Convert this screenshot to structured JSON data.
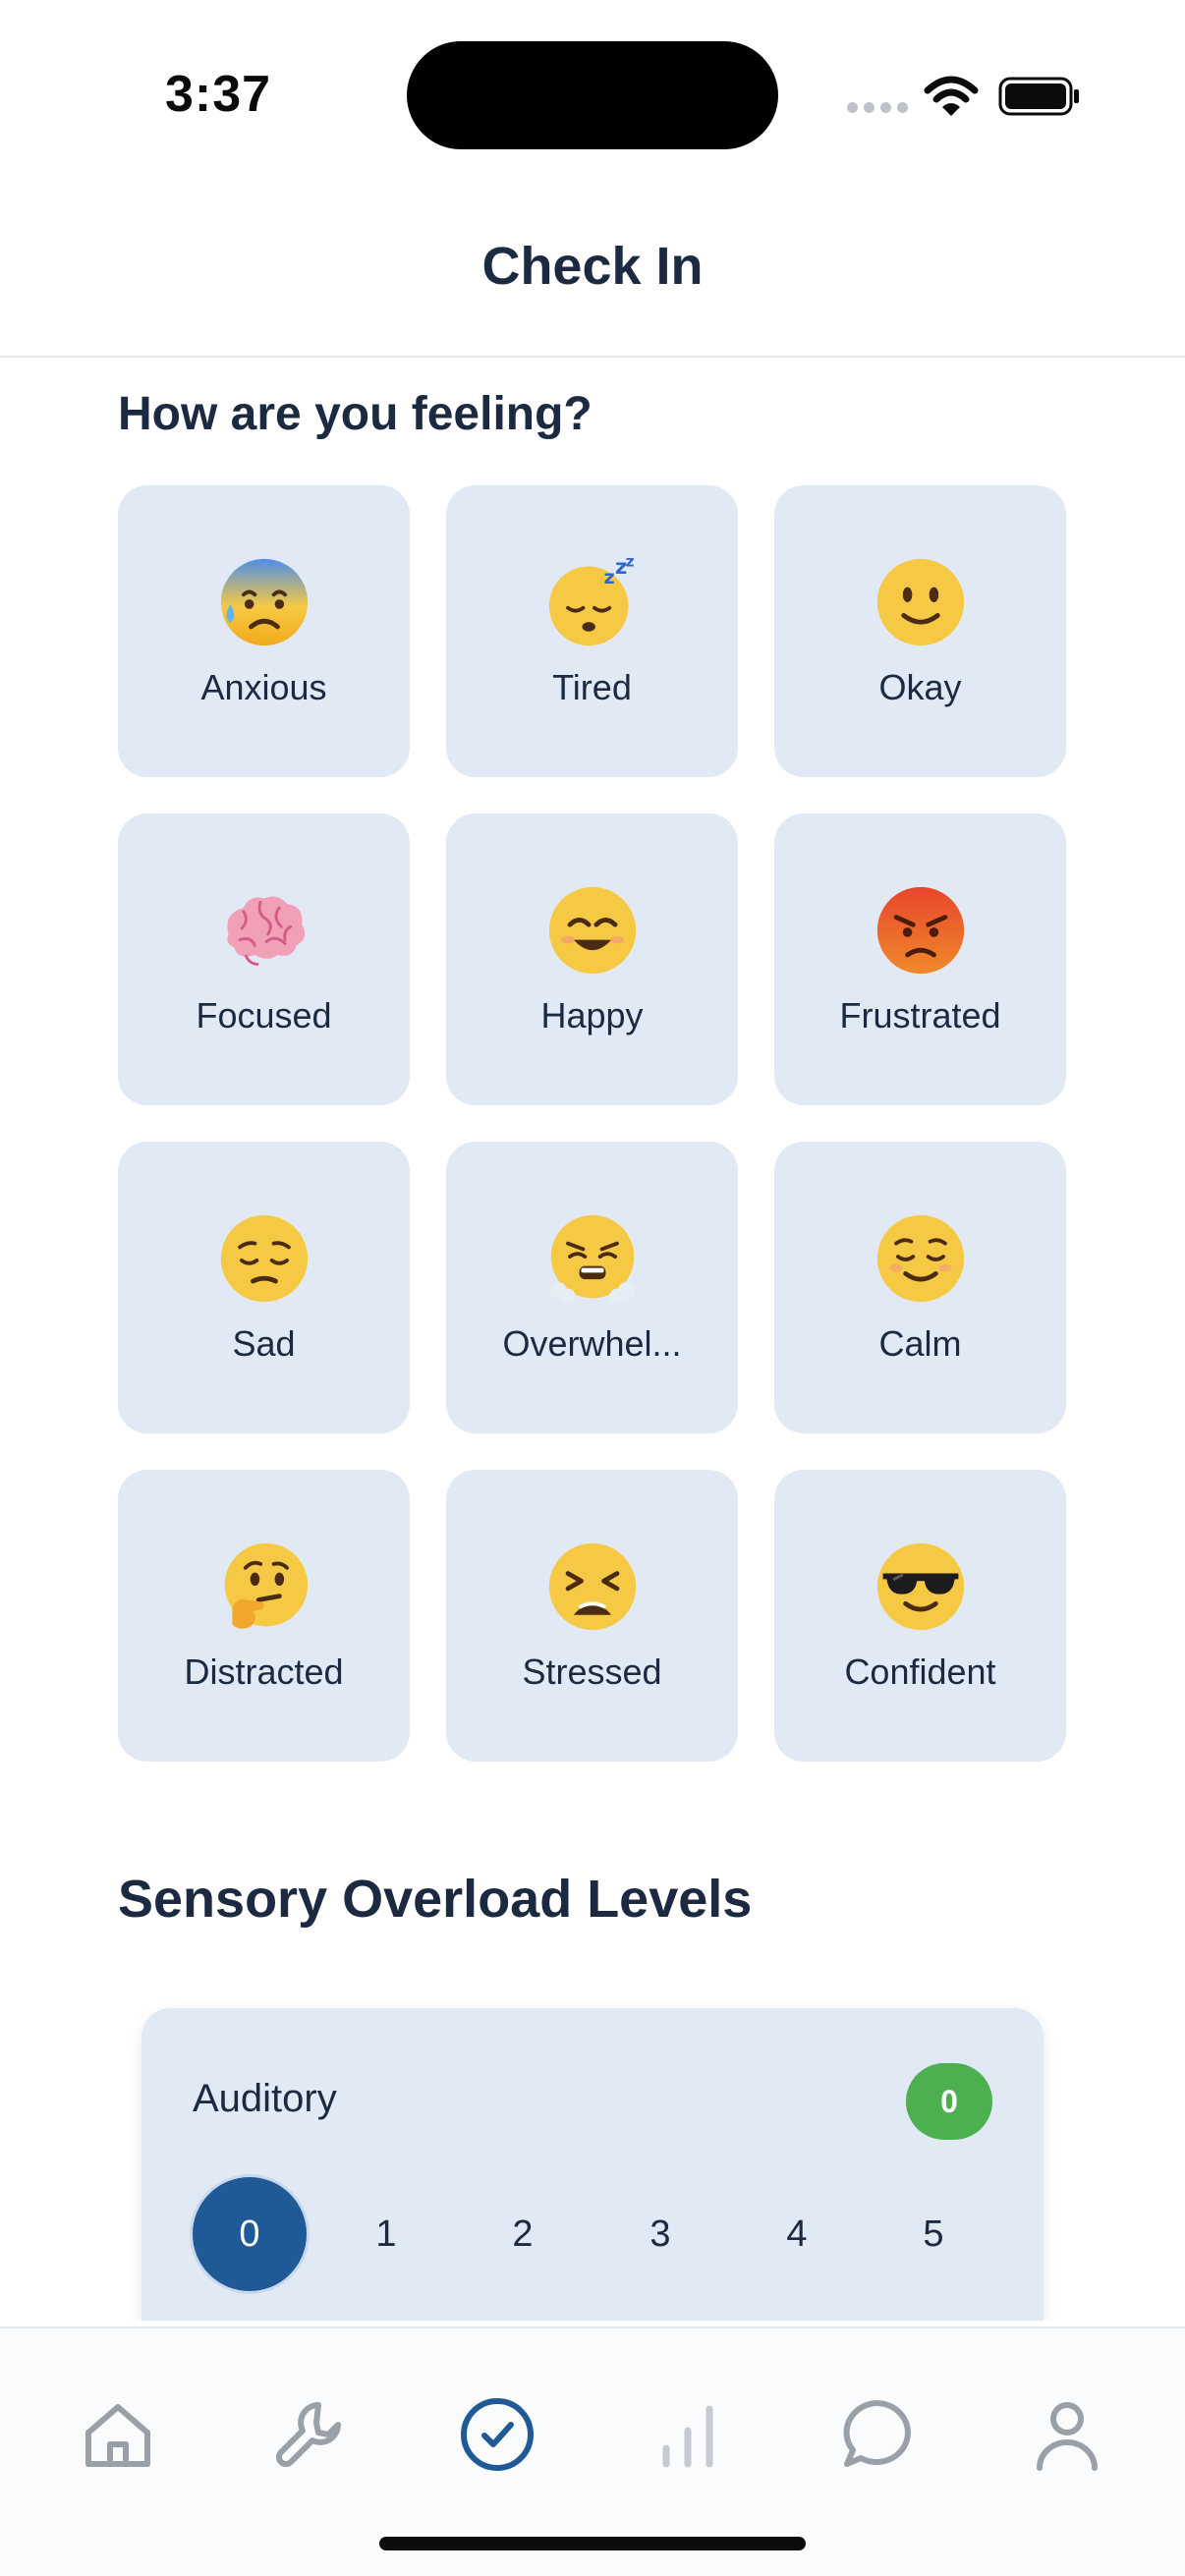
{
  "status_bar": {
    "time": "3:37"
  },
  "header": {
    "title": "Check In"
  },
  "mood_section": {
    "title": "How are you feeling?",
    "moods": [
      {
        "label": "Anxious",
        "icon": "anxious-sweat-face-icon"
      },
      {
        "label": "Tired",
        "icon": "sleeping-face-icon"
      },
      {
        "label": "Okay",
        "icon": "slightly-smiling-face-icon"
      },
      {
        "label": "Focused",
        "icon": "brain-icon"
      },
      {
        "label": "Happy",
        "icon": "smiling-face-icon"
      },
      {
        "label": "Frustrated",
        "icon": "angry-face-icon"
      },
      {
        "label": "Sad",
        "icon": "pensive-face-icon"
      },
      {
        "label": "Overwhel...",
        "icon": "steam-nose-face-icon"
      },
      {
        "label": "Calm",
        "icon": "relieved-face-icon"
      },
      {
        "label": "Distracted",
        "icon": "thinking-face-icon"
      },
      {
        "label": "Stressed",
        "icon": "tired-face-icon"
      },
      {
        "label": "Confident",
        "icon": "sunglasses-face-icon"
      }
    ]
  },
  "sensory_section": {
    "title": "Sensory Overload Levels",
    "auditory": {
      "label": "Auditory",
      "value": "0",
      "options": [
        "0",
        "1",
        "2",
        "3",
        "4",
        "5"
      ],
      "selected_index": 0
    }
  },
  "tab_bar": {
    "tabs": [
      {
        "icon": "home-icon"
      },
      {
        "icon": "wrench-icon"
      },
      {
        "icon": "checkmark-circle-icon",
        "active": true
      },
      {
        "icon": "bar-chart-icon"
      },
      {
        "icon": "chat-bubble-icon"
      },
      {
        "icon": "profile-icon"
      }
    ]
  },
  "colors": {
    "accent": "#1f5a96",
    "card_background": "#e1e9f5",
    "text_primary": "#1b2a40",
    "badge_green": "#4caf50",
    "tab_inactive": "#9aa0a8"
  }
}
